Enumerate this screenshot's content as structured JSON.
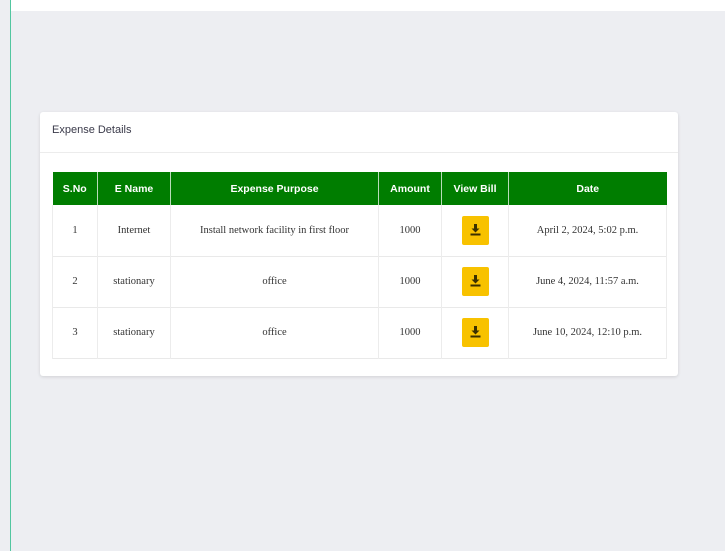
{
  "card": {
    "title": "Expense Details"
  },
  "table": {
    "headers": {
      "sno": "S.No",
      "ename": "E Name",
      "purpose": "Expense Purpose",
      "amount": "Amount",
      "view_bill": "View Bill",
      "date": "Date"
    },
    "rows": [
      {
        "sno": "1",
        "ename": "Internet",
        "purpose": "Install network facility in first floor",
        "amount": "1000",
        "bill_icon": "download-icon",
        "date": "April 2, 2024, 5:02 p.m."
      },
      {
        "sno": "2",
        "ename": "stationary",
        "purpose": "office",
        "amount": "1000",
        "bill_icon": "download-icon",
        "date": "June 4, 2024, 11:57 a.m."
      },
      {
        "sno": "3",
        "ename": "stationary",
        "purpose": "office",
        "amount": "1000",
        "bill_icon": "download-icon",
        "date": "June 10, 2024, 12:10 p.m."
      }
    ]
  },
  "colors": {
    "header_bg": "#007d00",
    "button_bg": "#f8c200",
    "page_bg": "#edeef2",
    "accent_rule": "#52c6a0"
  }
}
